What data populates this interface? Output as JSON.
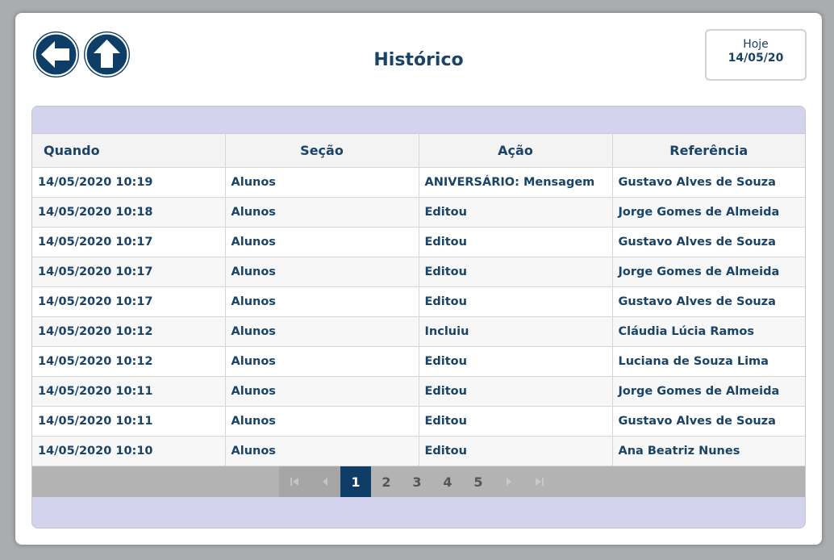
{
  "header": {
    "title": "Histórico",
    "today_label": "Hoje",
    "today_date": "14/05/20"
  },
  "table": {
    "columns": [
      "Quando",
      "Seção",
      "Ação",
      "Referência"
    ],
    "rows": [
      {
        "quando": "14/05/2020 10:19",
        "secao": "Alunos",
        "acao": "ANIVERSÁRIO: Mensagem",
        "referencia": "Gustavo Alves de Souza"
      },
      {
        "quando": "14/05/2020 10:18",
        "secao": "Alunos",
        "acao": "Editou",
        "referencia": "Jorge Gomes de Almeida"
      },
      {
        "quando": "14/05/2020 10:17",
        "secao": "Alunos",
        "acao": "Editou",
        "referencia": "Gustavo Alves de Souza"
      },
      {
        "quando": "14/05/2020 10:17",
        "secao": "Alunos",
        "acao": "Editou",
        "referencia": "Jorge Gomes de Almeida"
      },
      {
        "quando": "14/05/2020 10:17",
        "secao": "Alunos",
        "acao": "Editou",
        "referencia": "Gustavo Alves de Souza"
      },
      {
        "quando": "14/05/2020 10:12",
        "secao": "Alunos",
        "acao": "Incluiu",
        "referencia": "Cláudia Lúcia Ramos"
      },
      {
        "quando": "14/05/2020 10:12",
        "secao": "Alunos",
        "acao": "Editou",
        "referencia": "Luciana de Souza Lima"
      },
      {
        "quando": "14/05/2020 10:11",
        "secao": "Alunos",
        "acao": "Editou",
        "referencia": "Jorge Gomes de Almeida"
      },
      {
        "quando": "14/05/2020 10:11",
        "secao": "Alunos",
        "acao": "Editou",
        "referencia": "Gustavo Alves de Souza"
      },
      {
        "quando": "14/05/2020 10:10",
        "secao": "Alunos",
        "acao": "Editou",
        "referencia": "Ana Beatriz Nunes"
      }
    ]
  },
  "pager": {
    "pages": [
      "1",
      "2",
      "3",
      "4",
      "5"
    ],
    "current": "1",
    "icons": {
      "first": "first-page-icon",
      "prev": "prev-page-icon",
      "next": "next-page-icon",
      "last": "last-page-icon"
    }
  },
  "icons": {
    "back": "arrow-left-icon",
    "up": "arrow-up-icon"
  },
  "colors": {
    "accent": "#0e3e67",
    "text": "#1a4368",
    "panel": "#d3d3ee",
    "pager": "#b3b3b3"
  }
}
